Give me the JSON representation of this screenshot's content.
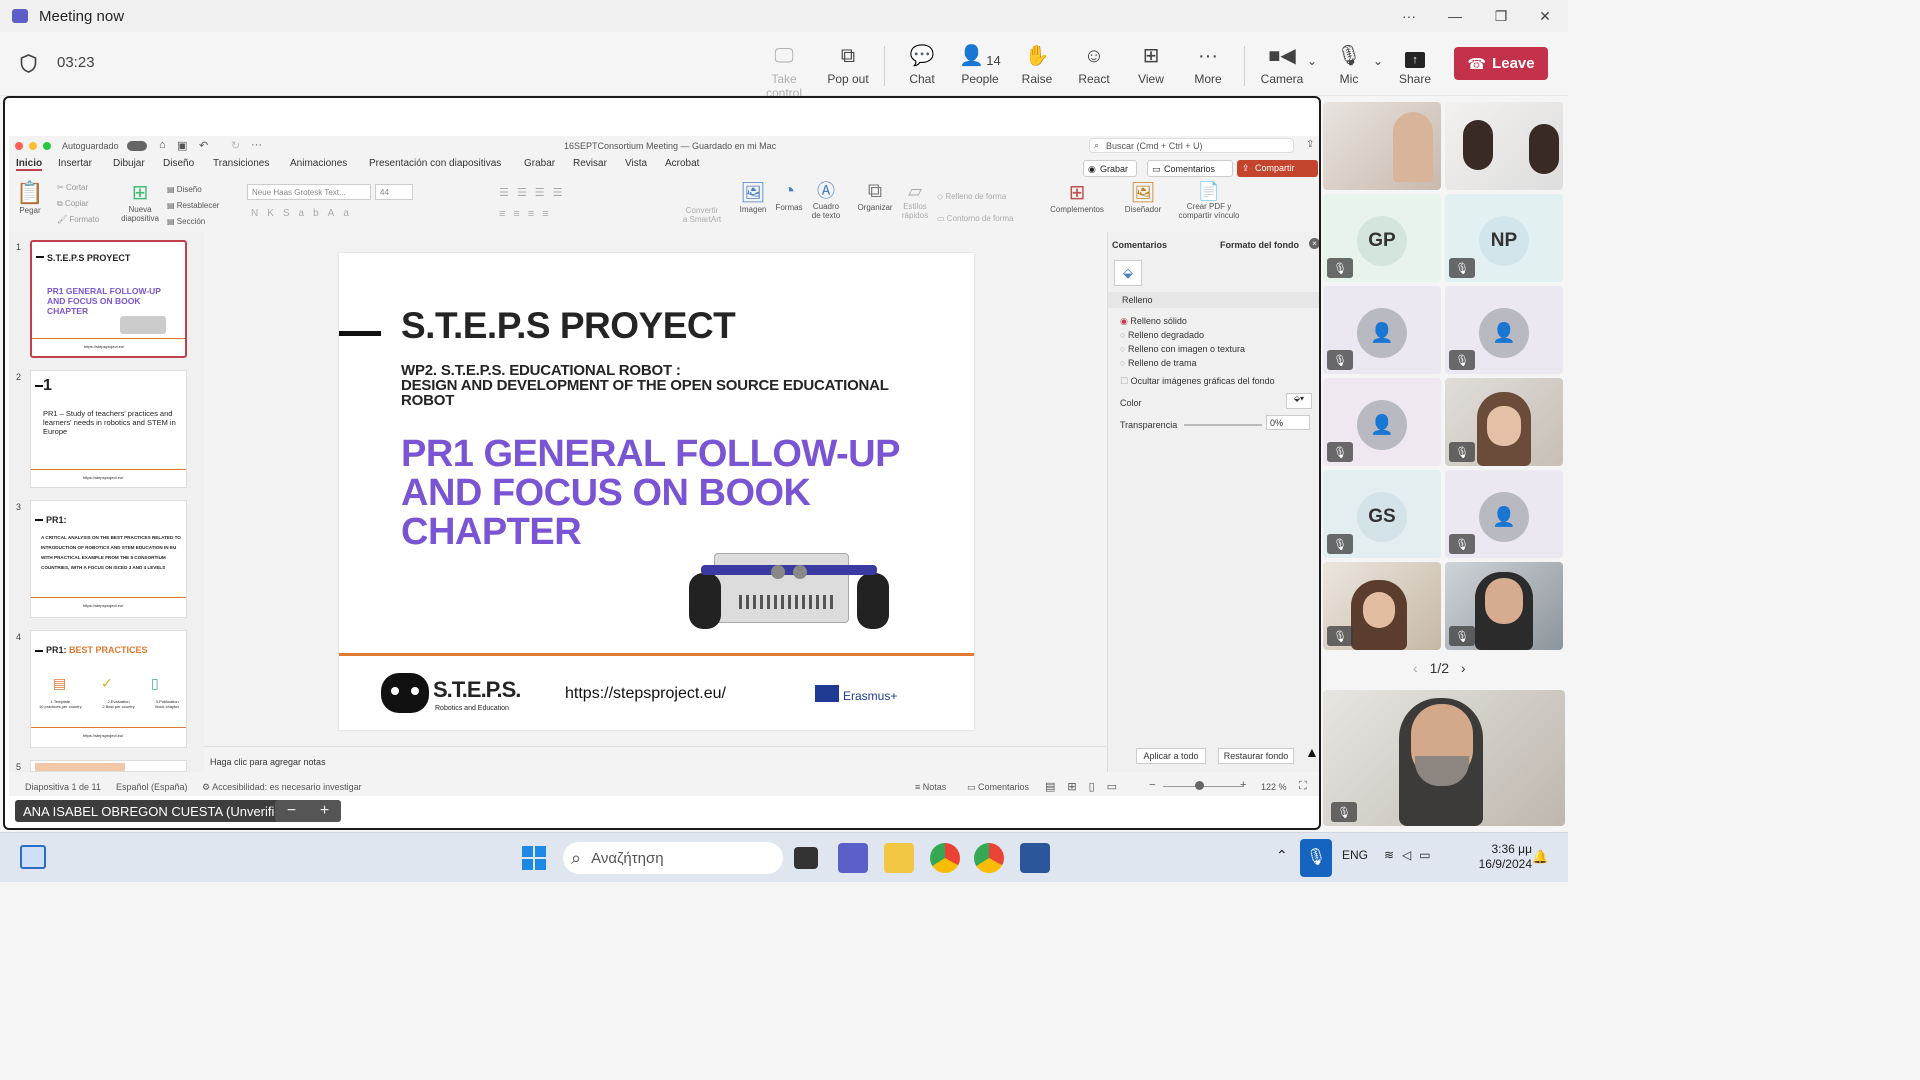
{
  "window": {
    "title": "Meeting now"
  },
  "meeting": {
    "timer": "03:23",
    "toolbar": {
      "take_control": "Take control",
      "pop_out": "Pop out",
      "chat": "Chat",
      "people": "People",
      "people_count": "14",
      "raise": "Raise",
      "react": "React",
      "view": "View",
      "more": "More",
      "camera": "Camera",
      "mic": "Mic",
      "share": "Share",
      "leave": "Leave"
    },
    "presenter_name": "ANA ISABEL OBREGON CUESTA (Unverified)",
    "pager": "1/2"
  },
  "ppt": {
    "autosave": "Autoguardado",
    "doc_title": "16SEPTConsortium Meeting — Guardado en mi Mac",
    "search_placeholder": "Buscar (Cmd + Ctrl + U)",
    "tabs": [
      "Inicio",
      "Insertar",
      "Dibujar",
      "Diseño",
      "Transiciones",
      "Animaciones",
      "Presentación con diapositivas",
      "Grabar",
      "Revisar",
      "Vista",
      "Acrobat"
    ],
    "grabar": "Grabar",
    "comentarios": "Comentarios",
    "compartir": "Compartir",
    "ribbon": {
      "pegar": "Pegar",
      "cortar": "Cortar",
      "copiar": "Copiar",
      "formato": "Formato",
      "nueva": "Nueva",
      "diapositiva": "diapositiva",
      "diseno": "Diseño",
      "restablecer": "Restablecer",
      "seccion": "Sección",
      "font": "Neue Haas Grotesk Text...",
      "size": "44",
      "convertir": "Convertir",
      "smartart": "a SmartArt",
      "imagen": "Imagen",
      "formas": "Formas",
      "cuadro": "Cuadro",
      "de_texto": "de texto",
      "organizar": "Organizar",
      "estilos": "Estilos",
      "rapidos": "rápidos",
      "relleno_forma": "Relleno de forma",
      "contorno_forma": "Contorno de forma",
      "complementos": "Complementos",
      "disenador": "Diseñador",
      "crear_pdf": "Crear PDF y",
      "compartir_vinculo": "compartir vínculo"
    },
    "thumbs": {
      "t1": {
        "title": "S.T.E.P.S PROYECT",
        "sub": "PR1 GENERAL FOLLOW-UP AND FOCUS ON BOOK CHAPTER"
      },
      "t2": {
        "num": "1",
        "text": "PR1 – Study of teachers' practices and learners' needs in robotics and STEM in Europe"
      },
      "t3": {
        "title": "PR1:",
        "text": "A CRITICAL ANALYSIS ON THE BEST PRACTICES RELATED TO INTRODUCTION OF ROBOTICS AND STEM EDUCATION IN EU WITH PRACTICAL EXAMPLE FROM THE 5 CONSORTIUM COUNTRIES, WITH A FOCUS ON ISCED 3 AND 4 LEVELS"
      },
      "t4": {
        "title_a": "PR1:",
        "title_b": "BEST PRACTICES",
        "i1": "1.Template",
        "i2": "2.Evaluation",
        "i3": "3.Publication",
        "s1": "10 practices per country",
        "s2": "2 Best per country",
        "s3": "Book chapter"
      },
      "footer_url": "https://stepsproject.eu/",
      "nums": [
        "1",
        "2",
        "3",
        "4",
        "5"
      ]
    },
    "slide": {
      "title": "S.T.E.P.S PROYECT",
      "wp_line1": "WP2. S.T.E.P.S. EDUCATIONAL ROBOT :",
      "wp_line2": "DESIGN AND DEVELOPMENT OF THE OPEN SOURCE EDUCATIONAL",
      "wp_line3": "ROBOT",
      "main_l1": "PR1 GENERAL FOLLOW-UP",
      "main_l2": "AND FOCUS ON BOOK",
      "main_l3": "CHAPTER",
      "logo_text": "S.T.E.P.S.",
      "logo_sub": "Robotics and Education",
      "url": "https://stepsproject.eu/",
      "erasmus": "Erasmus+"
    },
    "pane": {
      "tab_comments": "Comentarios",
      "tab_format": "Formato del fondo",
      "section": "Relleno",
      "options": [
        "Relleno sólido",
        "Relleno degradado",
        "Relleno con imagen o textura",
        "Relleno de trama"
      ],
      "hide": "Ocultar imágenes gráficas del fondo",
      "color": "Color",
      "transparency": "Transparencia",
      "transparency_value": "0%",
      "apply_all": "Aplicar a todo",
      "reset": "Restaurar fondo"
    },
    "notes_placeholder": "Haga clic para agregar notas",
    "status": {
      "slide": "Diapositiva 1 de 11",
      "lang": "Español (España)",
      "access": "Accesibilidad: es necesario investigar",
      "notas": "Notas",
      "comentarios": "Comentarios",
      "zoom": "122 %"
    }
  },
  "gallery": [
    {
      "initials": "",
      "kind": "video"
    },
    {
      "initials": "",
      "kind": "video"
    },
    {
      "initials": "GP",
      "kind": "avatar"
    },
    {
      "initials": "NP",
      "kind": "avatar"
    },
    {
      "initials": "",
      "kind": "generic"
    },
    {
      "initials": "",
      "kind": "generic"
    },
    {
      "initials": "",
      "kind": "generic"
    },
    {
      "initials": "",
      "kind": "video"
    },
    {
      "initials": "GS",
      "kind": "avatar"
    },
    {
      "initials": "",
      "kind": "generic"
    },
    {
      "initials": "",
      "kind": "video"
    },
    {
      "initials": "",
      "kind": "video"
    }
  ],
  "taskbar": {
    "search_placeholder": "Αναζήτηση",
    "lang": "ENG",
    "time": "3:36 μμ",
    "date": "16/9/2024"
  },
  "colors": {
    "accent": "#5b5fc7",
    "leave": "#c4314b",
    "purple": "#7a55d3",
    "orange": "#e07a30"
  }
}
